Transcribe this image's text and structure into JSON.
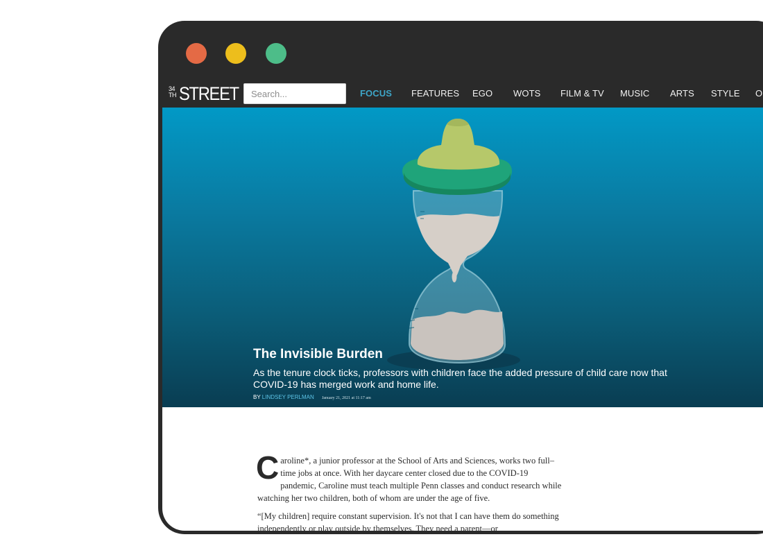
{
  "window": {
    "controls": [
      "close",
      "minimize",
      "maximize"
    ]
  },
  "logo": {
    "numerals": [
      "34",
      "TH"
    ],
    "word": "STREET"
  },
  "search": {
    "placeholder": "Search..."
  },
  "nav": {
    "items": [
      "FOCUS",
      "FEATURES",
      "EGO",
      "WOTS",
      "FILM & TV",
      "MUSIC",
      "ARTS",
      "STYLE",
      "O"
    ],
    "active": "FOCUS"
  },
  "hero": {
    "title": "The Invisible Burden",
    "subtitle": "As the tenure clock ticks, professors with children face the added pressure of child care now that COVID-19 has merged work and home life.",
    "byline_prefix": "BY",
    "author": "LINDSEY PERLMAN",
    "date": "January 21, 2021 at 11:17 am",
    "illustration": "baby-bottle-hourglass"
  },
  "article": {
    "dropcap": "C",
    "paragraph1": "aroline*, a junior professor at the School of Arts and Sciences, works two full–time jobs at once. With her daycare center closed due to the COVID-19 pandemic, Caroline must teach multiple Penn classes and conduct research while watching her two children, both of whom are under the age of five.",
    "paragraph2": "“[My children] require constant supervision. It's not that I can have them do something independently or play outside by themselves. They need a parent—or"
  },
  "colors": {
    "frame": "#2a2a2a",
    "accent": "#3ea6c8",
    "dot_red": "#e46a45",
    "dot_yellow": "#edbe1c",
    "dot_green": "#4dbd89"
  }
}
